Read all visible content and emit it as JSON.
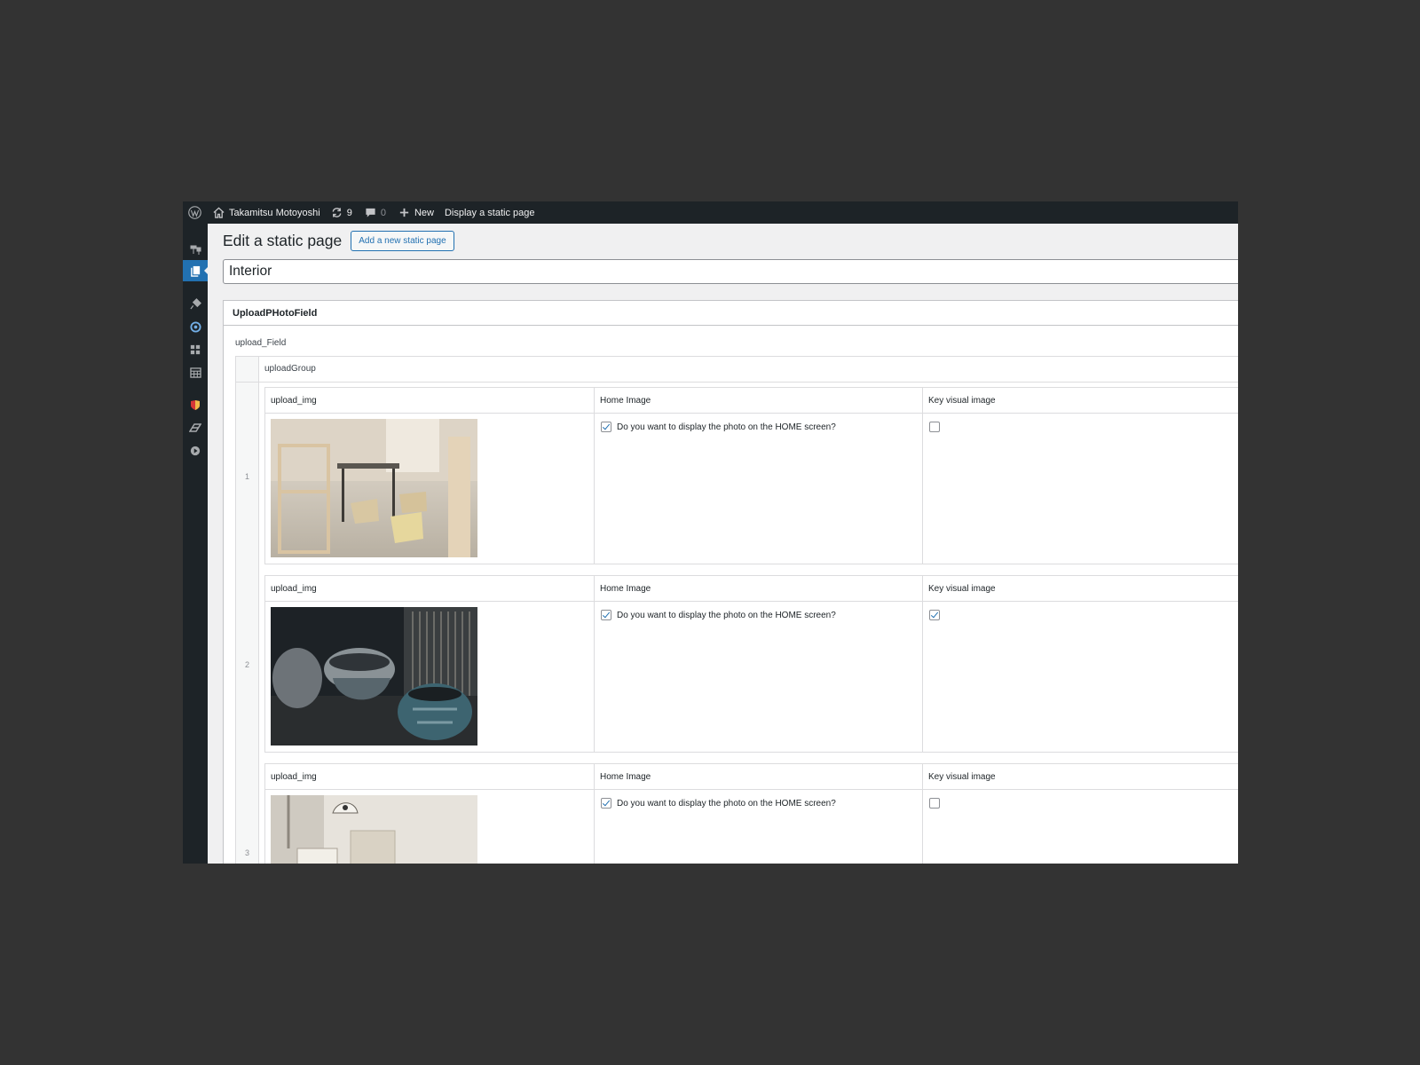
{
  "adminbar": {
    "site_name": "Takamitsu Motoyoshi",
    "updates_count": "9",
    "comments_count": "0",
    "new_label": "New",
    "view_label": "Display a static page"
  },
  "header": {
    "title": "Edit a static page",
    "add_button": "Add a new static page"
  },
  "post_title": "Interior",
  "metabox": {
    "title": "UploadPHotoField",
    "field_label": "upload_Field",
    "group_label": "uploadGroup"
  },
  "columns": {
    "img": "upload_img",
    "home": "Home Image",
    "key": "Key visual image"
  },
  "rows": [
    {
      "num": "1",
      "home_text": "Do you want to display the photo on the HOME screen?",
      "home_checked": true,
      "key_checked": false
    },
    {
      "num": "2",
      "home_text": "Do you want to display the photo on the HOME screen?",
      "home_checked": true,
      "key_checked": true
    },
    {
      "num": "3",
      "home_text": "Do you want to display the photo on the HOME screen?",
      "home_checked": true,
      "key_checked": false
    }
  ],
  "colors": {
    "accent": "#2271b1",
    "adminbar": "#1d2327",
    "backdrop": "#333333"
  }
}
